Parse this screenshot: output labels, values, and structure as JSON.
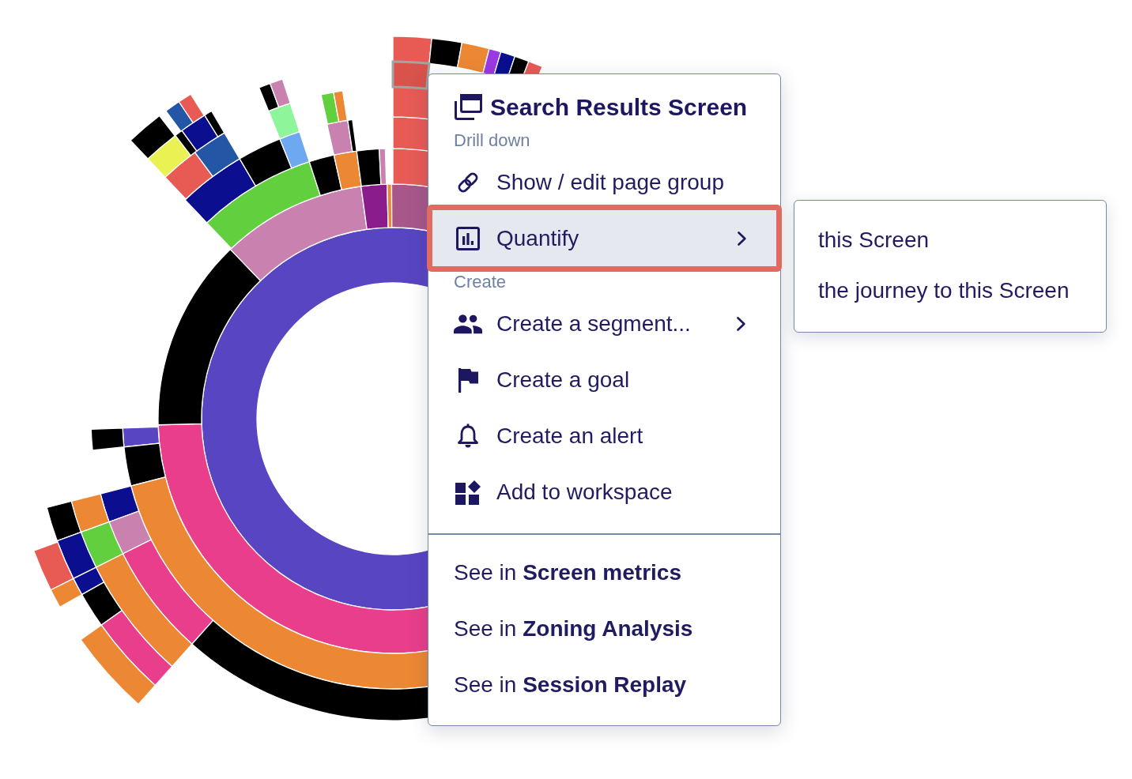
{
  "context_menu": {
    "title": "Search Results Screen",
    "sections": [
      {
        "label": "Drill down",
        "items": [
          {
            "label": "Show / edit page group",
            "selected": false,
            "outlined": false,
            "has_submenu": false
          },
          {
            "label": "Quantify",
            "selected": true,
            "outlined": true,
            "has_submenu": true
          }
        ]
      },
      {
        "label": "Create",
        "items": [
          {
            "label": "Create a segment...",
            "selected": false,
            "outlined": false,
            "has_submenu": true
          },
          {
            "label": "Create a goal",
            "selected": false,
            "outlined": false,
            "has_submenu": false
          },
          {
            "label": "Create an alert",
            "selected": false,
            "outlined": false,
            "has_submenu": false
          },
          {
            "label": "Add to workspace",
            "selected": false,
            "outlined": false,
            "has_submenu": false
          }
        ]
      }
    ],
    "links": [
      {
        "label": "See in **Screen metrics**",
        "selected": false
      },
      {
        "label": "See in **Zoning Analysis**",
        "selected": false
      },
      {
        "label": "See in **Session Replay**",
        "selected": false
      }
    ]
  },
  "submenu": {
    "items": [
      {
        "label": "this Screen",
        "selected": false
      },
      {
        "label": "the journey to this Screen",
        "selected": false
      }
    ]
  }
}
